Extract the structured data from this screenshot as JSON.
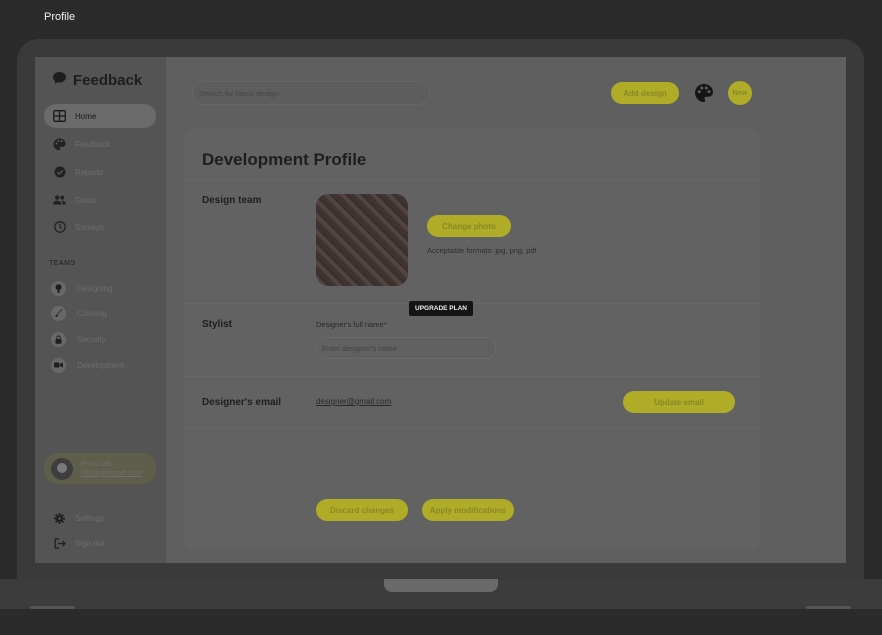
{
  "window": {
    "title": "Profile"
  },
  "sidebar": {
    "brand": "Feedback",
    "items": [
      {
        "label": "Home",
        "icon": "grid-icon",
        "active": true
      },
      {
        "label": "Feedback",
        "icon": "palette-icon"
      },
      {
        "label": "Reports",
        "icon": "check-circle-icon"
      },
      {
        "label": "Goals",
        "icon": "people-icon"
      },
      {
        "label": "Surveys",
        "icon": "clock-icon"
      }
    ],
    "teams_label": "TEAMS",
    "teams": [
      {
        "label": "Designing",
        "icon": "bulb-icon"
      },
      {
        "label": "Coloring",
        "icon": "brush-icon"
      },
      {
        "label": "Security",
        "icon": "lock-icon"
      },
      {
        "label": "Development",
        "icon": "code-icon"
      }
    ],
    "profile": {
      "name": "PrintCraft",
      "email": "info@printcraft.com"
    },
    "settings_label": "Settings",
    "signout_label": "Sign out"
  },
  "header": {
    "search_placeholder": "Search for fabric design",
    "add_design_label": "Add design",
    "new_label": "New"
  },
  "profile_card": {
    "title": "Development Profile",
    "design_team_label": "Design team",
    "change_photo_label": "Change photo",
    "formats_text": "Acceptable formats: jpg, png, pdf",
    "tooltip": "UPGRADE PLAN",
    "stylist_label": "Stylist",
    "designer_name_label": "Designer's full name*",
    "designer_name_placeholder": "Enter designer's name",
    "email_label": "Designer's email",
    "email_value": "designer@gmail.com",
    "update_email_label": "Update email",
    "discard_label": "Discard changes",
    "apply_label": "Apply modifications"
  },
  "colors": {
    "accent": "#b0ac28",
    "screen_bg": "#5f5f5f",
    "sidebar_bg": "#545454"
  }
}
